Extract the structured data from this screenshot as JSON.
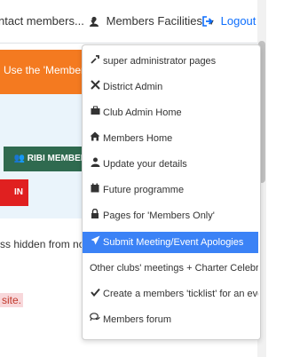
{
  "navbar": {
    "contact_label": "ntact members...",
    "members_label": "Members Facilities",
    "logout_label": "Logout"
  },
  "page": {
    "orange_text": "Use the 'Members Fa",
    "green_button": "RIBI MEMBER",
    "red_button": "IN",
    "hidden_text": "ss hidden from non",
    "site_text": "site."
  },
  "dropdown": {
    "items": [
      {
        "label": "super administrator pages",
        "icon": "wrench-icon"
      },
      {
        "label": "District Admin",
        "icon": "tools-icon"
      },
      {
        "label": "Club Admin Home",
        "icon": "briefcase-icon"
      },
      {
        "label": "Members Home",
        "icon": "home-icon"
      },
      {
        "label": "Update your details",
        "icon": "user-icon"
      },
      {
        "label": "Future programme",
        "icon": "calendar-icon"
      },
      {
        "label": "Pages for 'Members Only'",
        "icon": "lock-icon"
      },
      {
        "label": "Submit Meeting/Event Apologies",
        "icon": "paper-plane-icon"
      },
      {
        "label": "Other clubs' meetings + Charter Celebrations",
        "icon": ""
      },
      {
        "label": "Create a members 'ticklist' for an event",
        "icon": "check-icon"
      },
      {
        "label": "Members forum",
        "icon": "comments-icon"
      }
    ],
    "active_color": "#3b82f6"
  },
  "colors": {
    "orange": "#f47a20",
    "green": "#2f6a4f",
    "red": "#e02020",
    "link": "#0d6efd"
  }
}
